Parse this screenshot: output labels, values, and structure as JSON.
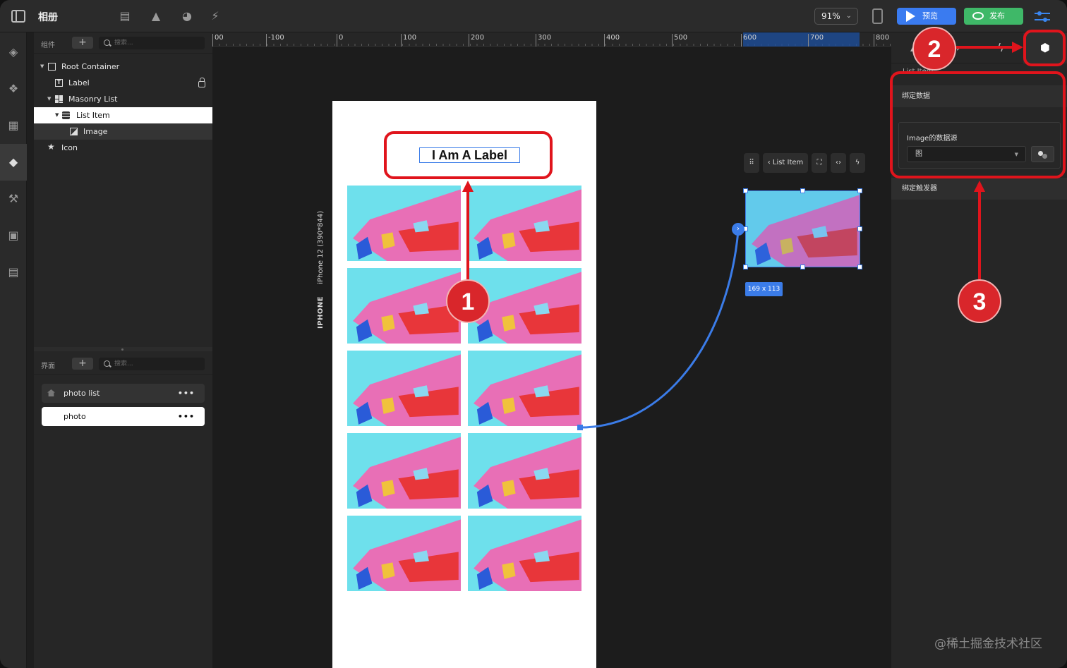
{
  "app": {
    "title": "相册"
  },
  "toolbar": {
    "zoom": "91%",
    "preview_label": "预览",
    "publish_label": "发布"
  },
  "components_panel": {
    "title": "组件",
    "search_placeholder": "搜索...",
    "tree": [
      {
        "label": "Root Container",
        "icon": "container-icon"
      },
      {
        "label": "Label",
        "icon": "text-icon",
        "locked": true
      },
      {
        "label": "Masonry List",
        "icon": "masonry-icon"
      },
      {
        "label": "List Item",
        "icon": "database-icon",
        "selected": true
      },
      {
        "label": "Image",
        "icon": "image-icon"
      },
      {
        "label": "Icon",
        "icon": "star-icon"
      }
    ]
  },
  "pages_panel": {
    "title": "界面",
    "search_placeholder": "搜索...",
    "pages": [
      {
        "label": "photo list",
        "more": "•••"
      },
      {
        "label": "photo",
        "more": "•••"
      }
    ]
  },
  "ruler": {
    "ticks": [
      "00",
      "-100",
      "0",
      "100",
      "200",
      "300",
      "400",
      "500",
      "600",
      "700",
      "800"
    ]
  },
  "canvas": {
    "device_name": "IPHONE",
    "device_detail": "iPhone 12 (390*844)",
    "label_text": "I Am A Label",
    "selection_size": "169 x 113",
    "float_toolbar_label": "List Item"
  },
  "inspector": {
    "subtitle": "List Item",
    "bind_data_title": "绑定数据",
    "field_label": "Image的数据源",
    "field_value": "图",
    "bind_trigger_title": "绑定触发器"
  },
  "annotations": [
    "1",
    "2",
    "3"
  ],
  "watermark": "@稀土掘金技术社区",
  "colors": {
    "accent": "#3a7bf0",
    "publish": "#3fb868",
    "annotation": "#e0141c"
  }
}
